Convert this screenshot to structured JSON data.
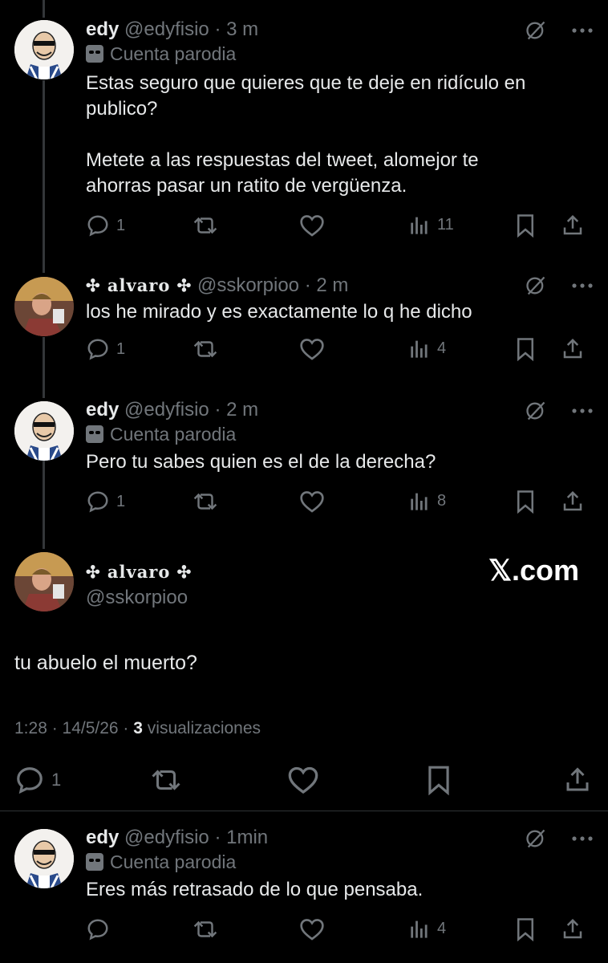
{
  "tweets": [
    {
      "display_name": "edy",
      "handle": "@edyfisio",
      "time": "· 3 m",
      "badge": "Cuenta parodia",
      "text": "Estas seguro que quieres que te deje en ridículo en\npublico?\n\nMetete a las respuestas del tweet, alomejor te\nahorras pasar un ratito de vergüenza.",
      "replies": "1",
      "views": "11"
    },
    {
      "display_name": "✣ alvaro ✣",
      "handle": "@sskorpioo",
      "time": "· 2 m",
      "text": "los he mirado y es exactamente lo q he dicho",
      "replies": "1",
      "views": "4"
    },
    {
      "display_name": "edy",
      "handle": "@edyfisio",
      "time": "· 2 m",
      "badge": "Cuenta parodia",
      "text": "Pero tu sabes quien es el de la derecha?",
      "replies": "1",
      "views": "8"
    }
  ],
  "focused": {
    "display_name": "✣ alvaro ✣",
    "handle": "@sskorpioo",
    "text": "tu abuelo el muerto?",
    "timestamp": "1:28 · 14/5/26 · ",
    "views_count": "3",
    "views_label": " visualizaciones",
    "replies": "1",
    "watermark": "𝕏.com"
  },
  "last_reply": {
    "display_name": "edy",
    "handle": "@edyfisio",
    "time": "· 1min",
    "badge": "Cuenta parodia",
    "text": "Eres más retrasado de lo que pensaba.",
    "views": "4"
  }
}
